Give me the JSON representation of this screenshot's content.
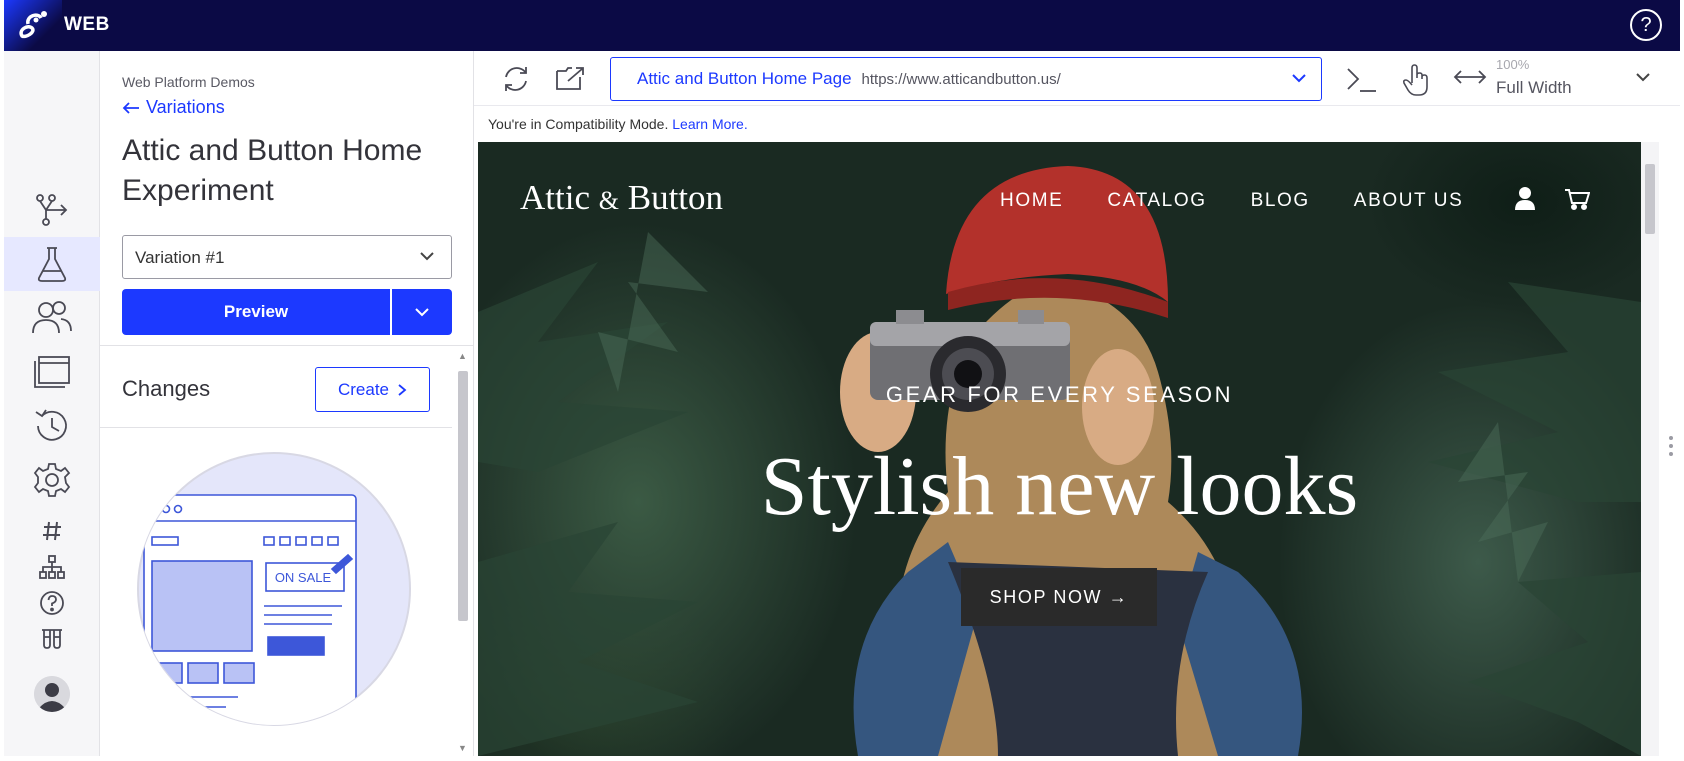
{
  "app": {
    "name": "WEB",
    "help_glyph": "?"
  },
  "rail": {
    "items": [
      {
        "name": "flow-icon"
      },
      {
        "name": "flask-icon",
        "active": true
      },
      {
        "name": "users-icon"
      },
      {
        "name": "pages-icon"
      },
      {
        "name": "history-icon"
      },
      {
        "name": "gear-icon"
      },
      {
        "name": "hash-icon"
      },
      {
        "name": "sitemap-icon"
      },
      {
        "name": "help-circle-icon"
      },
      {
        "name": "labs-icon"
      }
    ]
  },
  "panel": {
    "breadcrumb": "Web Platform Demos",
    "back_label": "Variations",
    "experiment_title": "Attic and Button Home Experiment",
    "variation_selected": "Variation #1",
    "preview_label": "Preview",
    "changes_title": "Changes",
    "create_label": "Create",
    "illustration_badge": "ON SALE"
  },
  "toolbar": {
    "url_page_name": "Attic and Button Home Page",
    "url_address": "https://www.atticandbutton.us/",
    "zoom": "100%",
    "width_mode": "Full Width"
  },
  "compat": {
    "message": "You're in Compatibility Mode.",
    "learn_more": "Learn More."
  },
  "site": {
    "logo_left": "Attic",
    "logo_amp": "&",
    "logo_right": "Button",
    "nav": [
      "HOME",
      "CATALOG",
      "BLOG",
      "ABOUT US"
    ],
    "tagline": "GEAR FOR EVERY SEASON",
    "headline": "Stylish new looks",
    "cta": "SHOP NOW →"
  },
  "colors": {
    "brand_blue": "#1c39ff",
    "top_bar": "#0b0a45"
  }
}
